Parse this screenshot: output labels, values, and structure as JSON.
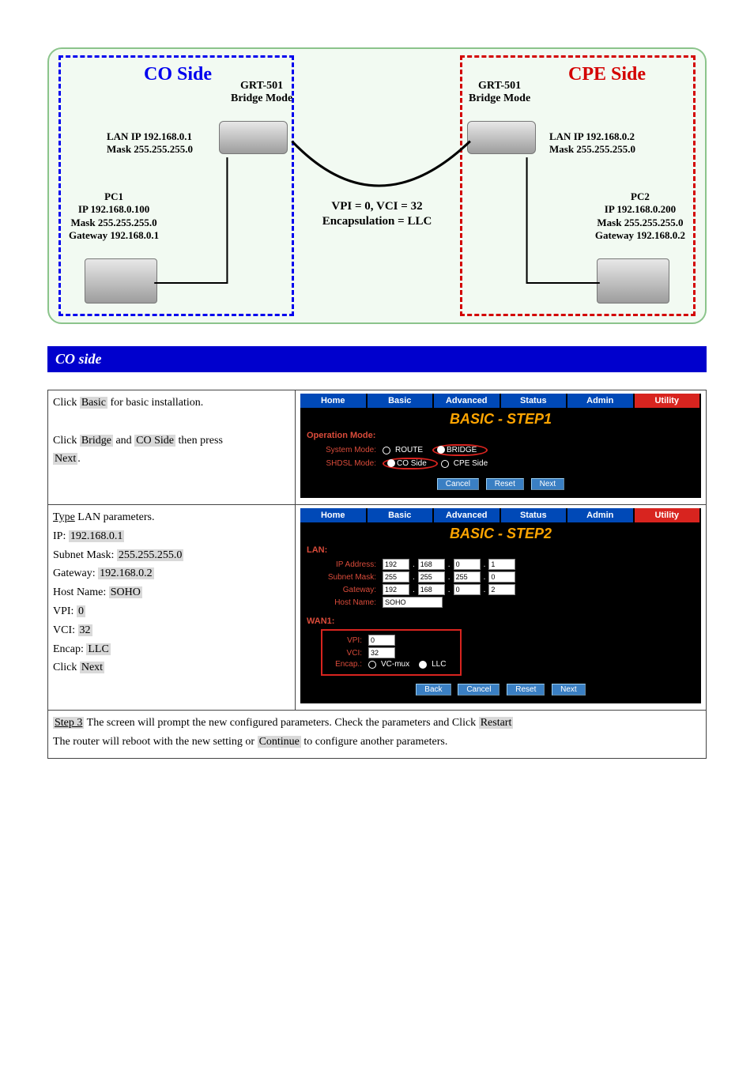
{
  "diagram": {
    "co_title": "CO Side",
    "cpe_title": "CPE Side",
    "co_device": "GRT-501\nBridge Mode",
    "cpe_device": "GRT-501\nBridge Mode",
    "co_lan": "LAN IP 192.168.0.1\nMask 255.255.255.0",
    "cpe_lan": "LAN IP 192.168.0.2\nMask 255.255.255.0",
    "pc1": "PC1\nIP 192.168.0.100\nMask 255.255.255.0\nGateway 192.168.0.1",
    "pc2": "PC2\nIP 192.168.0.200\nMask 255.255.255.0\nGateway 192.168.0.2",
    "center": "VPI = 0, VCI = 32\nEncapsulation = LLC"
  },
  "bluebar": "CO side",
  "tabs": [
    "Home",
    "Basic",
    "Advanced",
    "Status",
    "Admin",
    "Utility"
  ],
  "row1": {
    "left_intro": "Click",
    "left_basic": "Basic",
    "left_after": " for basic installation.",
    "left_click": "Click ",
    "left_bridge": "Bridge",
    "left_and": " and ",
    "left_co": "CO Side",
    "left_then": " then press ",
    "left_next": "Next",
    "left_dot": ".",
    "title": "BASIC - STEP1",
    "opmode": "Operation Mode:",
    "sysmode_lbl": "System Mode:",
    "route": "ROUTE",
    "bridge": "BRIDGE",
    "shdsl_lbl": "SHDSL Mode:",
    "coside": "CO Side",
    "cpeside": "CPE Side",
    "btn_cancel": "Cancel",
    "btn_reset": "Reset",
    "btn_next": "Next"
  },
  "row2": {
    "left_l1a": "Type",
    "left_l1b": " LAN parameters.",
    "left_ip_lbl": "IP: ",
    "left_ip": "192.168.0.1",
    "left_sm_lbl": "Subnet Mask: ",
    "left_sm": "255.255.255.0",
    "left_gw_lbl": "Gateway: ",
    "left_gw": "192.168.0.2",
    "left_hn_lbl": "Host Name: ",
    "left_hn": "SOHO",
    "left_vpi_lbl": "VPI: ",
    "left_vpi": "0",
    "left_vci_lbl": "VCI: ",
    "left_vci": "32",
    "left_encap_lbl": "Encap: ",
    "left_encap": "LLC",
    "left_click": "Click ",
    "left_next": "Next",
    "title": "BASIC - STEP2",
    "lan": "LAN:",
    "ip_lbl": "IP Address:",
    "ip": [
      "192",
      "168",
      "0",
      "1"
    ],
    "sm_lbl": "Subnet Mask:",
    "sm": [
      "255",
      "255",
      "255",
      "0"
    ],
    "gw_lbl": "Gateway:",
    "gw": [
      "192",
      "168",
      "0",
      "2"
    ],
    "hn_lbl": "Host Name:",
    "hn": "SOHO",
    "wan": "WAN1:",
    "vpi_lbl": "VPI:",
    "vpi": "0",
    "vci_lbl": "VCI:",
    "vci": "32",
    "encap_lbl": "Encap.:",
    "vcmux": "VC-mux",
    "llc": "LLC",
    "btn_back": "Back",
    "btn_cancel": "Cancel",
    "btn_reset": "Reset",
    "btn_next": "Next"
  },
  "row3": {
    "l1": "Step 3",
    "l2_a": " The screen will prompt the new configured parameters. Check the parameters and Click ",
    "l2_restart": "Restart",
    "l2_b": " The router will reboot with the new setting or ",
    "l2_continue": "Continue",
    "l2_c": " to configure another parameters."
  }
}
